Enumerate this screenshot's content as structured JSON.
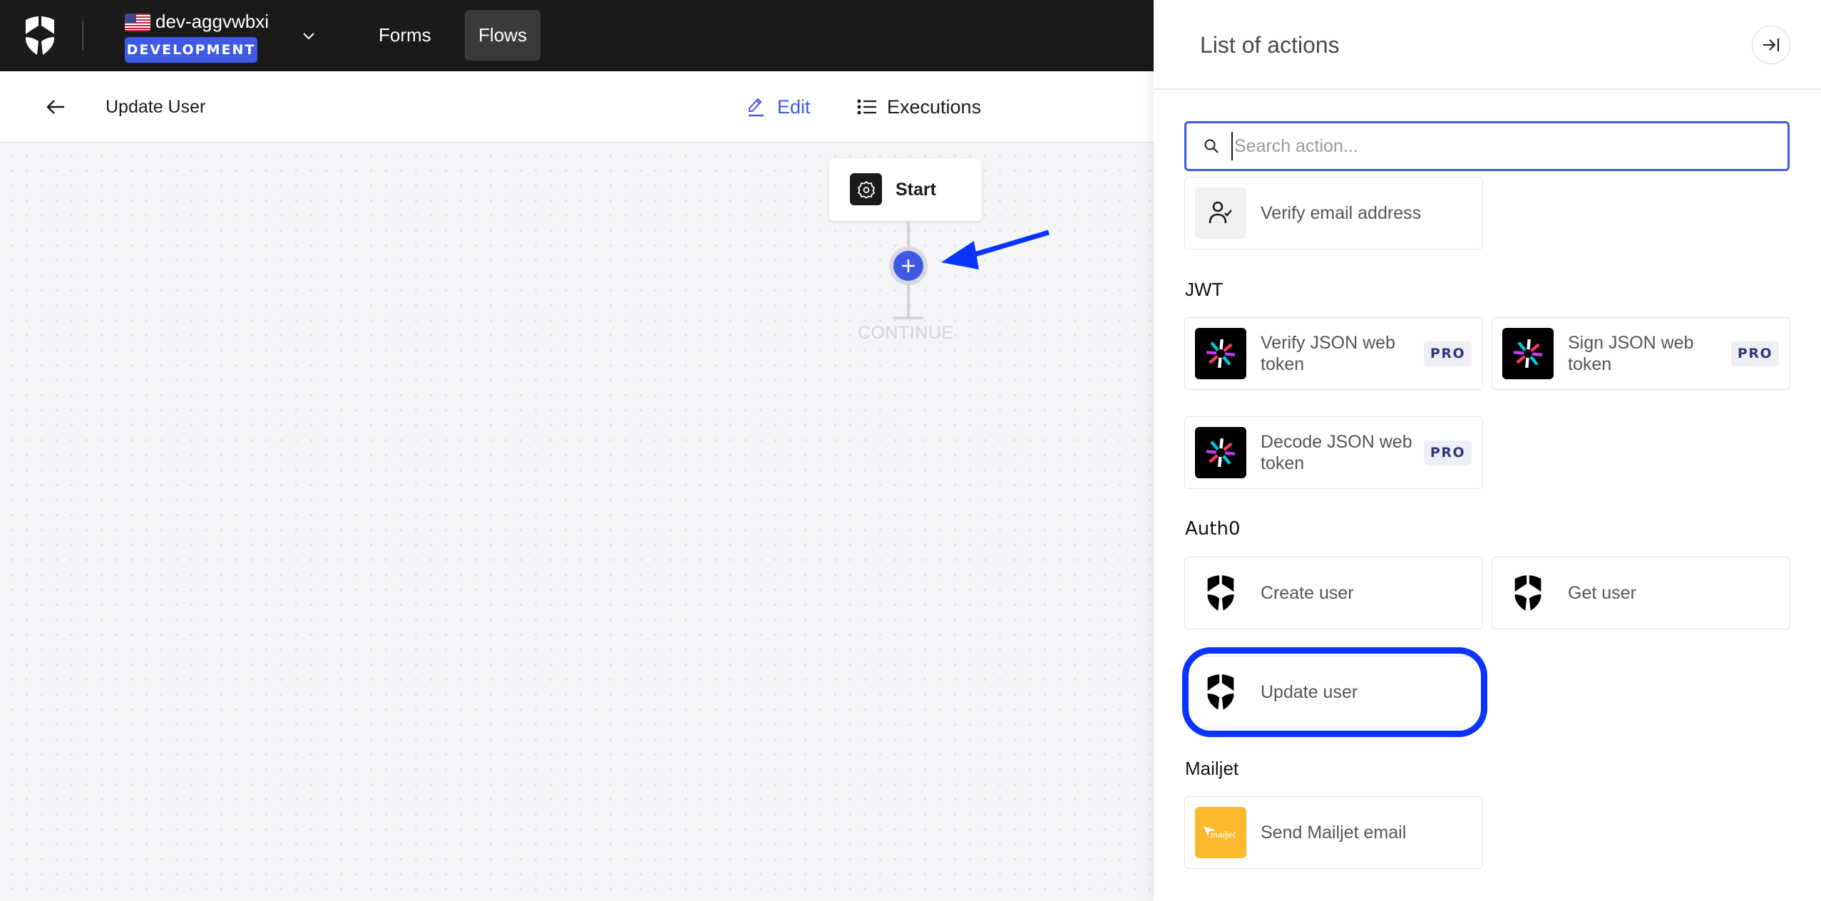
{
  "topnav": {
    "tenant_name": "dev-aggvwbxi",
    "environment_badge": "DEVELOPMENT",
    "links": [
      {
        "label": "Forms",
        "active": false
      },
      {
        "label": "Flows",
        "active": true
      }
    ]
  },
  "subheader": {
    "flow_title": "Update User",
    "tabs": [
      {
        "label": "Edit",
        "icon": "pencil-icon",
        "active": true
      },
      {
        "label": "Executions",
        "icon": "list-icon",
        "active": false
      }
    ]
  },
  "canvas": {
    "start_node_label": "Start",
    "continue_label": "CONTINUE"
  },
  "panel": {
    "title": "List of actions",
    "search": {
      "value": "",
      "placeholder": "Search action..."
    },
    "sections": [
      {
        "name": "",
        "actions": [
          {
            "label": "Verify email address",
            "icon": "user-check-icon",
            "pro": false
          }
        ]
      },
      {
        "name": "JWT",
        "actions": [
          {
            "label": "Verify JSON web token",
            "icon": "jwt-icon",
            "pro": true,
            "badge": "PRO"
          },
          {
            "label": "Sign JSON web token",
            "icon": "jwt-icon",
            "pro": true,
            "badge": "PRO"
          },
          {
            "label": "Decode JSON web token",
            "icon": "jwt-icon",
            "pro": true,
            "badge": "PRO"
          }
        ]
      },
      {
        "name": "Auth0",
        "actions": [
          {
            "label": "Create user",
            "icon": "auth0-shield-icon",
            "pro": false
          },
          {
            "label": "Get user",
            "icon": "auth0-shield-icon",
            "pro": false
          },
          {
            "label": "Update user",
            "icon": "auth0-shield-icon",
            "pro": false,
            "highlighted": true
          }
        ]
      },
      {
        "name": "Mailjet",
        "actions": [
          {
            "label": "Send Mailjet email",
            "icon": "mailjet-icon",
            "pro": false,
            "icon_text": "mailjet"
          }
        ]
      }
    ]
  },
  "colors": {
    "accent": "#3f59e4",
    "nav_bg": "#1a1a1a",
    "annotation": "#0a33ff",
    "mailjet": "#fbb92d",
    "pro_text": "#2c3a7a"
  }
}
